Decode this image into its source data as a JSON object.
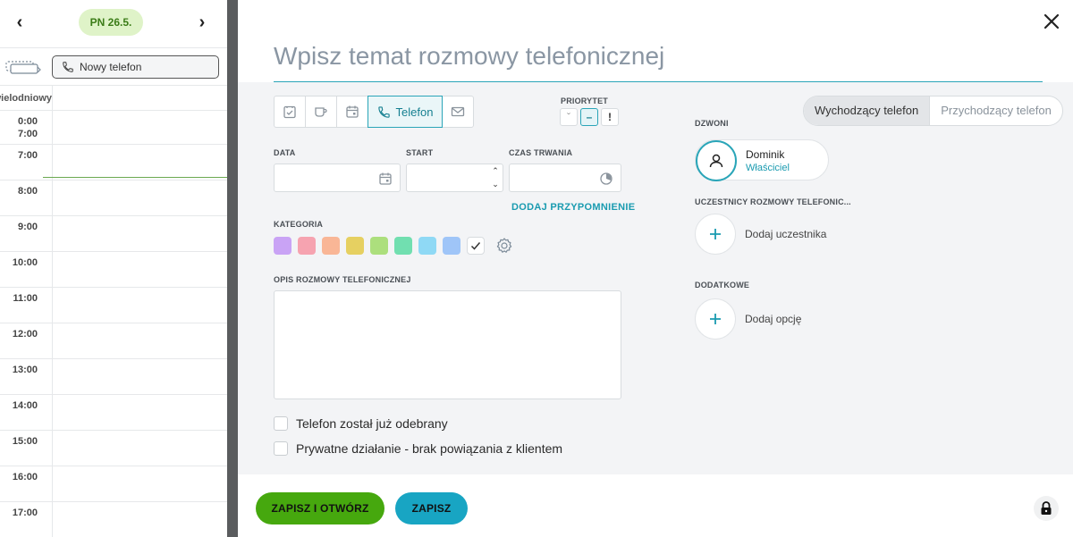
{
  "calendar": {
    "prev_arrow": "‹",
    "next_arrow": "›",
    "date_pill": "PN 26.5.",
    "new_button_label": "Nowy telefon",
    "allday_label": "Celodenní / wielodniowy",
    "first_time_top": "0:00",
    "first_time_bottom": "7:00",
    "times": [
      "7:00",
      "8:00",
      "9:00",
      "10:00",
      "11:00",
      "12:00",
      "13:00",
      "14:00",
      "15:00",
      "16:00",
      "17:00"
    ]
  },
  "modal": {
    "title_placeholder": "Wpisz temat rozmowy telefonicznej",
    "type_active_label": "Telefon",
    "priority_label": "PRIORYTET",
    "priority_options": [
      "ˇ",
      "–",
      "!"
    ],
    "date_label": "DATA",
    "start_label": "START",
    "duration_label": "CZAS TRWANIA",
    "reminder_link": "DODAJ PRZYPOMNIENIE",
    "category_label": "KATEGORIA",
    "category_colors": [
      "#c9a3f5",
      "#f6a3b0",
      "#f9b696",
      "#e6d061",
      "#acdf7d",
      "#71dfb0",
      "#8fd9f5",
      "#9fc5f8"
    ],
    "description_label": "OPIS ROZMOWY TELEFONICZNEJ",
    "checkbox_answered": "Telefon został już odebrany",
    "checkbox_private": "Prywatne działanie - brak powiązania z klientem",
    "direction_outgoing": "Wychodzący telefon",
    "direction_incoming": "Przychodzący telefon",
    "caller_label": "DZWONI",
    "caller_name": "Dominik",
    "caller_role": "Właściciel",
    "participants_label": "UCZESTNICY ROZMOWY TELEFONIC...",
    "add_participant": "Dodaj uczestnika",
    "extra_label": "DODATKOWE",
    "add_option": "Dodaj opcję",
    "save_open_button": "ZAPISZ I OTWÓRZ",
    "save_button": "ZAPISZ"
  },
  "colors": {
    "accent": "#2aa5b8",
    "save_green": "#46a80e",
    "save_blue": "#18a5c3"
  }
}
